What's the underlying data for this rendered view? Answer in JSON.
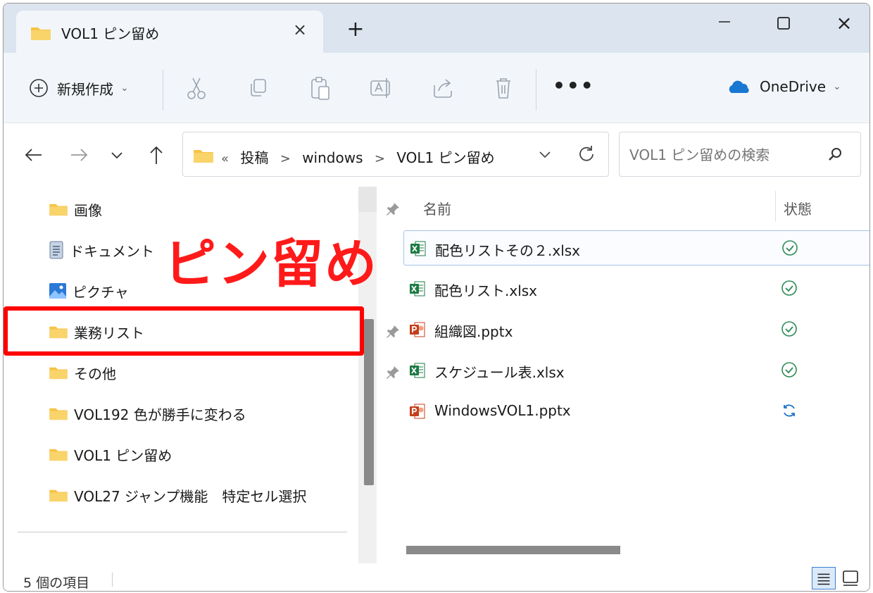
{
  "tab": {
    "title": "VOL1 ピン留め",
    "close": "×",
    "new_tab": "+"
  },
  "window_controls": {
    "minimize": "—",
    "close": "×"
  },
  "command_bar": {
    "new_label": "新規作成",
    "more": "•••",
    "onedrive_label": "OneDrive"
  },
  "address": {
    "crumbs": [
      "投稿",
      "windows",
      "VOL1 ピン留め"
    ],
    "overflow": "«",
    "separator": ">"
  },
  "search": {
    "placeholder": "VOL1 ピン留めの検索"
  },
  "sidebar": {
    "items": [
      {
        "label": "画像",
        "icon": "folder-icon",
        "pinned": true
      },
      {
        "label": "ドキュメント",
        "icon": "document-icon",
        "pinned": false
      },
      {
        "label": "ピクチャ",
        "icon": "pictures-icon",
        "pinned": false
      },
      {
        "label": "業務リスト",
        "icon": "folder-icon",
        "pinned": true
      },
      {
        "label": "その他",
        "icon": "folder-icon",
        "pinned": true
      },
      {
        "label": "VOL192 色が勝手に変わる",
        "icon": "folder-icon",
        "pinned": false
      },
      {
        "label": "VOL1 ピン留め",
        "icon": "folder-icon",
        "pinned": false
      },
      {
        "label": "VOL27 ジャンプ機能　特定セル選択",
        "icon": "folder-icon",
        "pinned": false
      }
    ]
  },
  "annotation": {
    "label": "ピン留め",
    "color": "#ff0000"
  },
  "file_list": {
    "columns": {
      "name": "名前",
      "status": "状態"
    },
    "files": [
      {
        "name": "配色リストその２.xlsx",
        "type": "excel",
        "status": "synced",
        "selected": true
      },
      {
        "name": "配色リスト.xlsx",
        "type": "excel",
        "status": "synced",
        "selected": false
      },
      {
        "name": "組織図.pptx",
        "type": "powerpoint",
        "status": "synced",
        "selected": false
      },
      {
        "name": "スケジュール表.xlsx",
        "type": "excel",
        "status": "synced",
        "selected": false
      },
      {
        "name": "WindowsVOL1.pptx",
        "type": "powerpoint",
        "status": "syncing",
        "selected": false
      }
    ]
  },
  "status_bar": {
    "count": "5 個の項目"
  },
  "colors": {
    "excel": "#1d7a44",
    "powerpoint": "#c43e1c",
    "synced": "#2e8b57",
    "syncing": "#1e74c8",
    "folder": "#f6c344",
    "onedrive": "#1877d0"
  }
}
